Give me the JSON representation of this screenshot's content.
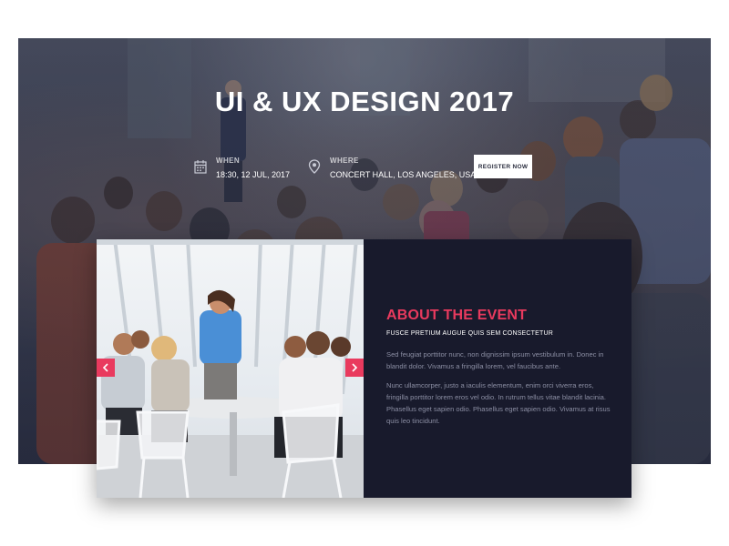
{
  "hero": {
    "title": "UI & UX DESIGN 2017",
    "when": {
      "icon": "calendar-icon",
      "label": "WHEN",
      "value": "18:30, 12 JUL, 2017"
    },
    "where": {
      "icon": "location-pin-icon",
      "label": "WHERE",
      "value": "CONCERT HALL, LOS ANGELES, USA"
    },
    "register_label": "REGISTER NOW"
  },
  "about": {
    "title": "ABOUT THE EVENT",
    "subtitle": "FUSCE PRETIUM AUGUE QUIS SEM CONSECTETUR",
    "paragraphs": [
      "Sed feugiat porttitor nunc, non dignissim ipsum vestibulum in. Donec in blandit dolor. Vivamus a fringilla lorem, vel faucibus ante.",
      "Nunc ullamcorper, justo a iaculis elementum, enim orci viverra eros, fringilla porttitor lorem eros vel odio. In rutrum tellus vitae blandit lacinia. Phasellus eget sapien odio. Phasellus eget sapien odio. Vivamus at risus quis leo tincidunt."
    ]
  },
  "slider": {
    "prev_icon": "chevron-left-icon",
    "next_icon": "chevron-right-icon"
  },
  "colors": {
    "accent": "#e93a5e",
    "panel": "#181a2c",
    "text_muted": "#8b8ea3"
  }
}
